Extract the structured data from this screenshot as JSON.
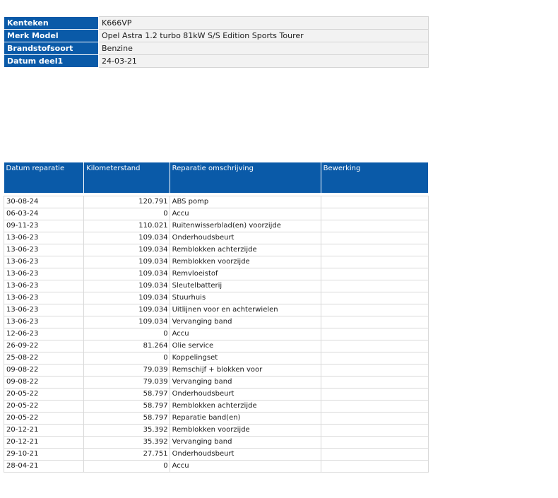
{
  "vehicle": {
    "rows": [
      {
        "label": "Kenteken",
        "value": "K666VP"
      },
      {
        "label": "Merk Model",
        "value": "Opel Astra 1.2 turbo 81kW S/S Edition Sports Tourer"
      },
      {
        "label": "Brandstofsoort",
        "value": "Benzine"
      },
      {
        "label": "Datum deel1",
        "value": "24-03-21"
      }
    ]
  },
  "repairs": {
    "headers": {
      "date": "Datum reparatie",
      "km": "Kilometerstand",
      "description": "Reparatie omschrijving",
      "edit": "Bewerking"
    },
    "rows": [
      {
        "date": "30-08-24",
        "km": "120.791",
        "description": "ABS pomp",
        "edit": ""
      },
      {
        "date": "06-03-24",
        "km": "0",
        "description": "Accu",
        "edit": ""
      },
      {
        "date": "09-11-23",
        "km": "110.021",
        "description": "Ruitenwisserblad(en) voorzijde",
        "edit": ""
      },
      {
        "date": "13-06-23",
        "km": "109.034",
        "description": "Onderhoudsbeurt",
        "edit": ""
      },
      {
        "date": "13-06-23",
        "km": "109.034",
        "description": "Remblokken achterzijde",
        "edit": ""
      },
      {
        "date": "13-06-23",
        "km": "109.034",
        "description": "Remblokken voorzijde",
        "edit": ""
      },
      {
        "date": "13-06-23",
        "km": "109.034",
        "description": "Remvloeistof",
        "edit": ""
      },
      {
        "date": "13-06-23",
        "km": "109.034",
        "description": "Sleutelbatterij",
        "edit": ""
      },
      {
        "date": "13-06-23",
        "km": "109.034",
        "description": "Stuurhuis",
        "edit": ""
      },
      {
        "date": "13-06-23",
        "km": "109.034",
        "description": "Uitlijnen voor en achterwielen",
        "edit": ""
      },
      {
        "date": "13-06-23",
        "km": "109.034",
        "description": "Vervanging band",
        "edit": ""
      },
      {
        "date": "12-06-23",
        "km": "0",
        "description": "Accu",
        "edit": ""
      },
      {
        "date": "26-09-22",
        "km": "81.264",
        "description": "Olie service",
        "edit": ""
      },
      {
        "date": "25-08-22",
        "km": "0",
        "description": "Koppelingset",
        "edit": ""
      },
      {
        "date": "09-08-22",
        "km": "79.039",
        "description": "Remschijf + blokken voor",
        "edit": ""
      },
      {
        "date": "09-08-22",
        "km": "79.039",
        "description": "Vervanging band",
        "edit": ""
      },
      {
        "date": "20-05-22",
        "km": "58.797",
        "description": "Onderhoudsbeurt",
        "edit": ""
      },
      {
        "date": "20-05-22",
        "km": "58.797",
        "description": "Remblokken achterzijde",
        "edit": ""
      },
      {
        "date": "20-05-22",
        "km": "58.797",
        "description": "Reparatie band(en)",
        "edit": ""
      },
      {
        "date": "20-12-21",
        "km": "35.392",
        "description": "Remblokken voorzijde",
        "edit": ""
      },
      {
        "date": "20-12-21",
        "km": "35.392",
        "description": "Vervanging band",
        "edit": ""
      },
      {
        "date": "29-10-21",
        "km": "27.751",
        "description": "Onderhoudsbeurt",
        "edit": ""
      },
      {
        "date": "28-04-21",
        "km": "0",
        "description": "Accu",
        "edit": ""
      }
    ]
  }
}
